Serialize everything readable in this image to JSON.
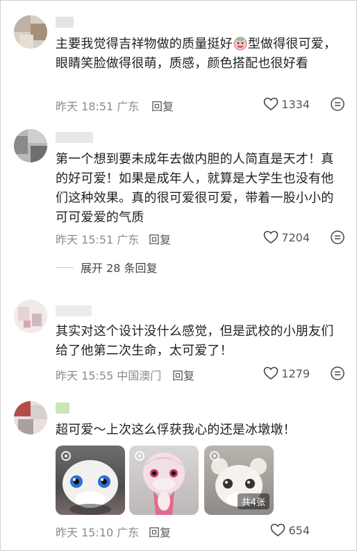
{
  "comments": [
    {
      "text_before_emoji": "主要我觉得吉祥物做的质量挺好",
      "text_after_emoji": "型做得很可爱，眼睛笑脸做得很萌，质感，颜色搭配也很好看",
      "emoji_icon": "smiling-face-sticker-icon",
      "time_location": "昨天 18:51 广东",
      "reply_label": "回复",
      "likes": "1334"
    },
    {
      "text": "第一个想到要未成年去做内胆的人简直是天才！真的好可爱！如果是成年人，就算是大学生也没有他们这种效果。真的很可爱很可爱，带着一股小小的可可爱爱的气质",
      "time_location": "昨天 15:51 广东",
      "reply_label": "回复",
      "likes": "7204",
      "expand_label": "展开 28 条回复"
    },
    {
      "text": "其实对这个设计没什么感觉，但是武校的小朋友们给了他第二次生命，太可爱了！",
      "time_location": "昨天 15:55 中国澳门",
      "reply_label": "回复",
      "likes": "1279"
    },
    {
      "text": "超可爱～上次这么俘获我心的还是冰墩墩！",
      "time_location": "昨天 15:10 广东",
      "reply_label": "回复",
      "likes": "654",
      "images_badge": "共4张"
    }
  ],
  "icons": {
    "like": "heart-outline-icon",
    "more": "comment-options-icon",
    "gif": "live-photo-icon"
  },
  "colors": {
    "text": "#1f1f1f",
    "meta": "#8a8a8a"
  }
}
